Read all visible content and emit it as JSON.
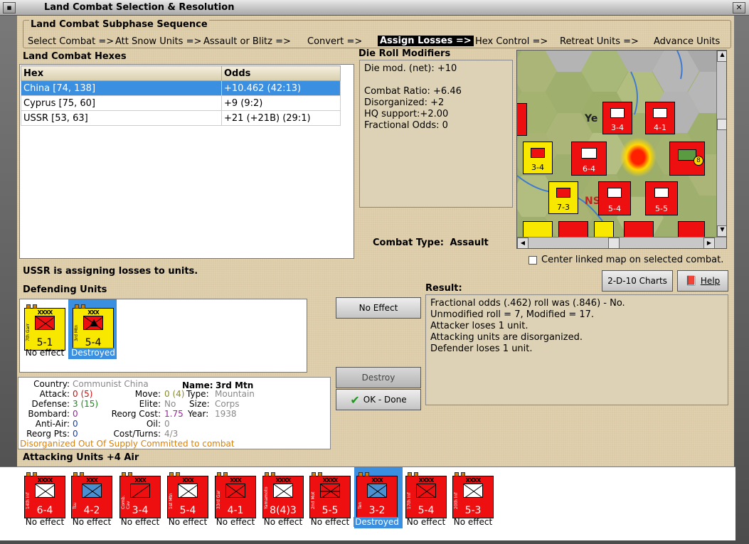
{
  "window": {
    "title": "Land Combat Selection & Resolution"
  },
  "subphase": {
    "header": "Land Combat Subphase Sequence",
    "steps": [
      "Select Combat =>",
      "Att Snow Units =>",
      "Assault or Blitz =>",
      "Convert =>",
      "Assign Losses =>",
      "Hex Control =>",
      "Retreat Units =>",
      "Advance Units"
    ],
    "active_index": 4
  },
  "hexes": {
    "header": "Land Combat Hexes",
    "columns": [
      "Hex",
      "Odds"
    ],
    "rows": [
      {
        "hex": "China [74, 138]",
        "odds": "+10.462 (42:13)"
      },
      {
        "hex": "Cyprus [75, 60]",
        "odds": "+9 (9:2)"
      },
      {
        "hex": "USSR [53, 63]",
        "odds": "+21 (+21B) (29:1)"
      }
    ],
    "selected_row": 0
  },
  "die_modifiers": {
    "header": "Die Roll Modifiers",
    "lines": [
      "Die mod. (net): +10",
      "",
      "Combat Ratio: +6.46",
      "Disorganized: +2",
      "HQ support:+2.00",
      "Fractional Odds: 0"
    ]
  },
  "combat_type": {
    "label": "Combat Type:",
    "value": "Assault"
  },
  "center_map": {
    "label": "Center linked map on selected combat.",
    "checked": false
  },
  "status_message": "USSR is assigning losses to units.",
  "buttons": {
    "charts": "2-D-10 Charts",
    "help": "Help",
    "no_effect": "No Effect",
    "destroy": "Destroy",
    "ok": "OK - Done"
  },
  "defending": {
    "header": "Defending Units",
    "units": [
      {
        "name": "7th Garr",
        "size": "XXXX",
        "strength": "5-1",
        "status": "No effect",
        "color": "yellow",
        "selected": false
      },
      {
        "name": "3rd Mtn",
        "size": "XXX",
        "strength": "5-4",
        "status": "Destroyed",
        "color": "yellow",
        "selected": true
      }
    ]
  },
  "result": {
    "header": "Result:",
    "lines": [
      "Fractional odds (.462) roll was (.846)  - No.",
      "Unmodified roll = 7, Modified = 17.",
      "Attacker loses 1 unit.",
      "Attacking units are disorganized.",
      "Defender loses 1 unit."
    ]
  },
  "unit_info": {
    "country_label": "Country:",
    "country": "Communist China",
    "name_label": "Name:",
    "name": "3rd Mtn",
    "attack_label": "Attack:",
    "attack": "0",
    "attack_base": "(5)",
    "defense_label": "Defense:",
    "defense": "3",
    "defense_base": "(15)",
    "bombard_label": "Bombard:",
    "bombard": "0",
    "antiair_label": "Anti-Air:",
    "antiair": "0",
    "reorg_label": "Reorg Pts:",
    "reorg": "0",
    "move_label": "Move:",
    "move": "0",
    "move_base": "(4)",
    "elite_label": "Elite:",
    "elite": "No",
    "reorg_cost_label": "Reorg Cost:",
    "reorg_cost": "1.75",
    "oil_label": "Oil:",
    "oil": "0",
    "cost_label": "Cost/Turns:",
    "cost": "4/3",
    "type_label": "Type:",
    "type": "Mountain",
    "size_label": "Size:",
    "size": "Corps",
    "year_label": "Year:",
    "year": "1938",
    "status1": "Disorganized",
    "status2": "Out Of Supply",
    "status3": "Committed to combat"
  },
  "attacking": {
    "header": "Attacking Units +4 Air",
    "units": [
      {
        "name": "14th Inf",
        "size": "XXXX",
        "strength": "6-4",
        "status": "No effect",
        "kind": "inf"
      },
      {
        "name": "Tsu",
        "size": "XXX",
        "strength": "4-2",
        "status": "No effect",
        "kind": "mar"
      },
      {
        "name": "Comb. Cav",
        "size": "XXX",
        "strength": "3-4",
        "status": "No effect",
        "kind": "cav"
      },
      {
        "name": "1st Mtn",
        "size": "XXX",
        "strength": "5-4",
        "status": "No effect",
        "kind": "inf"
      },
      {
        "name": "33rd Gar",
        "size": "XXX",
        "strength": "4-1",
        "status": "No effect",
        "kind": "gar"
      },
      {
        "name": "Yamamoto",
        "size": "XXXX",
        "strength": "8(4)3",
        "status": "No effect",
        "kind": "inf"
      },
      {
        "name": "2nd Mot",
        "size": "XXXX",
        "strength": "5-5",
        "status": "No effect",
        "kind": "mot"
      },
      {
        "name": "Ten",
        "size": "XXX",
        "strength": "3-2",
        "status": "Destroyed",
        "kind": "mar"
      },
      {
        "name": "17th Inf",
        "size": "XXXX",
        "strength": "5-4",
        "status": "No effect",
        "kind": "gar"
      },
      {
        "name": "20th Inf",
        "size": "XXXX",
        "strength": "5-3",
        "status": "No effect",
        "kind": "inf"
      }
    ]
  },
  "map_labels": {
    "city": "Ye",
    "region": "NS"
  },
  "map_counters": [
    {
      "strength": "3-4",
      "color": "red"
    },
    {
      "strength": "4-1",
      "color": "red"
    },
    {
      "strength": "3-4",
      "color": "yellow"
    },
    {
      "strength": "6-4",
      "color": "red"
    },
    {
      "strength": "7-3",
      "color": "yellow"
    },
    {
      "strength": "5-4",
      "color": "red"
    },
    {
      "strength": "5-5",
      "color": "red"
    }
  ]
}
